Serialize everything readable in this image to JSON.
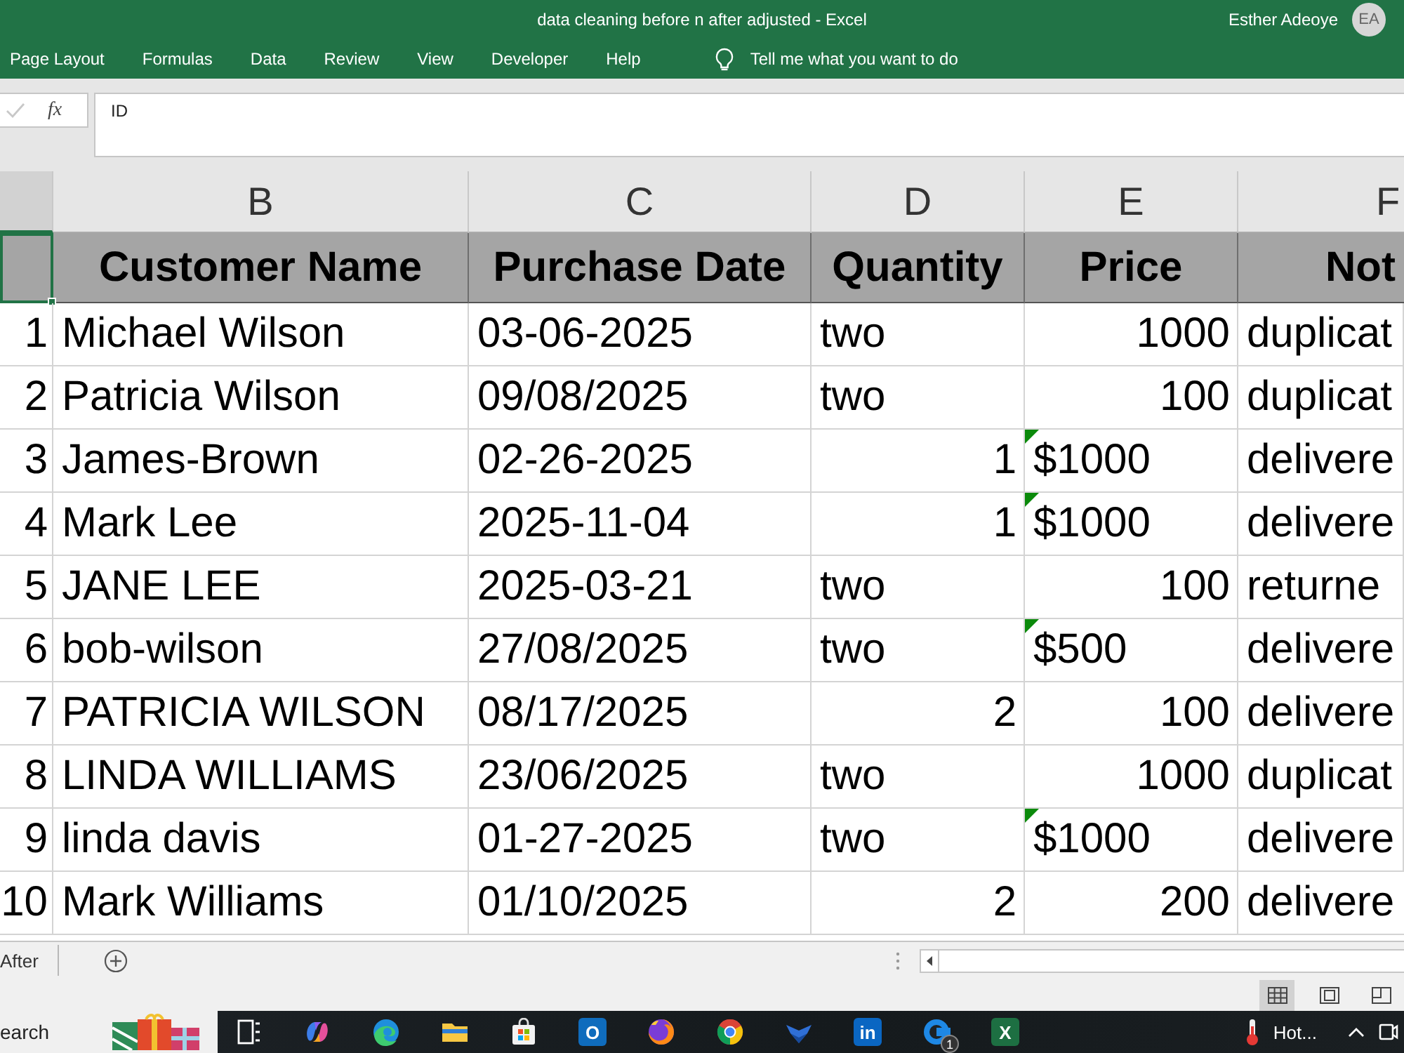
{
  "window": {
    "title": "data cleaning before n after adjusted - Excel",
    "user_name": "Esther Adeoye",
    "user_initials": "EA"
  },
  "ribbon": {
    "tabs": [
      {
        "label": "Page Layout",
        "selected": false
      },
      {
        "label": "Formulas",
        "selected": false
      },
      {
        "label": "Data",
        "selected": false
      },
      {
        "label": "Review",
        "selected": false
      },
      {
        "label": "View",
        "selected": false
      },
      {
        "label": "Developer",
        "selected": false
      },
      {
        "label": "Help",
        "selected": false
      }
    ],
    "tell_me": "Tell me what you want to do"
  },
  "formula_bar": {
    "enter_disabled": true,
    "function_label": "fx",
    "value": "ID"
  },
  "sheet": {
    "leftmost_column_selected": true,
    "column_headers": [
      "B",
      "C",
      "D",
      "E",
      "F"
    ],
    "header_row": [
      "Customer Name",
      "Purchase Date",
      "Quantity",
      "Price",
      "Not"
    ],
    "rows": [
      {
        "cells": [
          {
            "text": "1",
            "right_aligned": true,
            "error_flag": false
          },
          {
            "text": "Michael Wilson",
            "right_aligned": false,
            "error_flag": false
          },
          {
            "text": "03-06-2025",
            "right_aligned": false,
            "error_flag": false
          },
          {
            "text": "two",
            "right_aligned": false,
            "error_flag": false
          },
          {
            "text": "1000",
            "right_aligned": true,
            "error_flag": false
          },
          {
            "text": "duplicat",
            "right_aligned": false,
            "error_flag": false
          }
        ]
      },
      {
        "cells": [
          {
            "text": "2",
            "right_aligned": true,
            "error_flag": false
          },
          {
            "text": "Patricia Wilson",
            "right_aligned": false,
            "error_flag": false
          },
          {
            "text": "09/08/2025",
            "right_aligned": false,
            "error_flag": false
          },
          {
            "text": "two",
            "right_aligned": false,
            "error_flag": false
          },
          {
            "text": "100",
            "right_aligned": true,
            "error_flag": false
          },
          {
            "text": "duplicat",
            "right_aligned": false,
            "error_flag": false
          }
        ]
      },
      {
        "cells": [
          {
            "text": "3",
            "right_aligned": true,
            "error_flag": false
          },
          {
            "text": "James-Brown",
            "right_aligned": false,
            "error_flag": false
          },
          {
            "text": "02-26-2025",
            "right_aligned": false,
            "error_flag": false
          },
          {
            "text": "1",
            "right_aligned": true,
            "error_flag": false
          },
          {
            "text": "$1000",
            "right_aligned": false,
            "error_flag": true
          },
          {
            "text": "delivere",
            "right_aligned": false,
            "error_flag": false
          }
        ]
      },
      {
        "cells": [
          {
            "text": "4",
            "right_aligned": true,
            "error_flag": false
          },
          {
            "text": "Mark Lee",
            "right_aligned": false,
            "error_flag": false
          },
          {
            "text": "2025-11-04",
            "right_aligned": false,
            "error_flag": false
          },
          {
            "text": "1",
            "right_aligned": true,
            "error_flag": false
          },
          {
            "text": "$1000",
            "right_aligned": false,
            "error_flag": true
          },
          {
            "text": "delivere",
            "right_aligned": false,
            "error_flag": false
          }
        ]
      },
      {
        "cells": [
          {
            "text": "5",
            "right_aligned": true,
            "error_flag": false
          },
          {
            "text": "JANE LEE",
            "right_aligned": false,
            "error_flag": false
          },
          {
            "text": "2025-03-21",
            "right_aligned": false,
            "error_flag": false
          },
          {
            "text": "two",
            "right_aligned": false,
            "error_flag": false
          },
          {
            "text": "100",
            "right_aligned": true,
            "error_flag": false
          },
          {
            "text": "returne",
            "right_aligned": false,
            "error_flag": false
          }
        ]
      },
      {
        "cells": [
          {
            "text": "6",
            "right_aligned": true,
            "error_flag": false
          },
          {
            "text": "bob-wilson",
            "right_aligned": false,
            "error_flag": false
          },
          {
            "text": "27/08/2025",
            "right_aligned": false,
            "error_flag": false
          },
          {
            "text": "two",
            "right_aligned": false,
            "error_flag": false
          },
          {
            "text": "$500",
            "right_aligned": false,
            "error_flag": true
          },
          {
            "text": "delivere",
            "right_aligned": false,
            "error_flag": false
          }
        ]
      },
      {
        "cells": [
          {
            "text": "7",
            "right_aligned": true,
            "error_flag": false
          },
          {
            "text": "PATRICIA WILSON",
            "right_aligned": false,
            "error_flag": false
          },
          {
            "text": "08/17/2025",
            "right_aligned": false,
            "error_flag": false
          },
          {
            "text": "2",
            "right_aligned": true,
            "error_flag": false
          },
          {
            "text": "100",
            "right_aligned": true,
            "error_flag": false
          },
          {
            "text": "delivere",
            "right_aligned": false,
            "error_flag": false
          }
        ]
      },
      {
        "cells": [
          {
            "text": "8",
            "right_aligned": true,
            "error_flag": false
          },
          {
            "text": "LINDA WILLIAMS",
            "right_aligned": false,
            "error_flag": false
          },
          {
            "text": "23/06/2025",
            "right_aligned": false,
            "error_flag": false
          },
          {
            "text": "two",
            "right_aligned": false,
            "error_flag": false
          },
          {
            "text": "1000",
            "right_aligned": true,
            "error_flag": false
          },
          {
            "text": "duplicat",
            "right_aligned": false,
            "error_flag": false
          }
        ]
      },
      {
        "cells": [
          {
            "text": "9",
            "right_aligned": true,
            "error_flag": false
          },
          {
            "text": "linda davis",
            "right_aligned": false,
            "error_flag": false
          },
          {
            "text": "01-27-2025",
            "right_aligned": false,
            "error_flag": false
          },
          {
            "text": "two",
            "right_aligned": false,
            "error_flag": false
          },
          {
            "text": "$1000",
            "right_aligned": false,
            "error_flag": true
          },
          {
            "text": "delivere",
            "right_aligned": false,
            "error_flag": false
          }
        ]
      },
      {
        "cells": [
          {
            "text": "10",
            "right_aligned": true,
            "error_flag": false
          },
          {
            "text": "Mark Williams",
            "right_aligned": false,
            "error_flag": false
          },
          {
            "text": "01/10/2025",
            "right_aligned": false,
            "error_flag": false
          },
          {
            "text": "2",
            "right_aligned": true,
            "error_flag": false
          },
          {
            "text": "200",
            "right_aligned": true,
            "error_flag": false
          },
          {
            "text": "delivere",
            "right_aligned": false,
            "error_flag": false
          }
        ]
      }
    ]
  },
  "sheet_tabs": {
    "tabs": [
      {
        "label": "After",
        "selected": false
      }
    ]
  },
  "status_bar": {
    "view_buttons": [
      {
        "kind": "normal",
        "selected": true
      },
      {
        "kind": "page_layout",
        "selected": false
      },
      {
        "kind": "page_break",
        "selected": false
      }
    ]
  },
  "taskbar": {
    "search": {
      "placeholder": "earch"
    },
    "apps": [
      {
        "kind": "task_view"
      },
      {
        "kind": "swirl"
      },
      {
        "kind": "wave"
      },
      {
        "kind": "folder"
      },
      {
        "kind": "bag"
      },
      {
        "kind": "mail",
        "text": "O"
      },
      {
        "kind": "globe"
      },
      {
        "kind": "ring"
      },
      {
        "kind": "chevron"
      },
      {
        "kind": "in",
        "text": "in"
      },
      {
        "kind": "chat",
        "badge": "1"
      },
      {
        "kind": "sheet",
        "text": "X"
      }
    ],
    "weather": "Hot..."
  }
}
